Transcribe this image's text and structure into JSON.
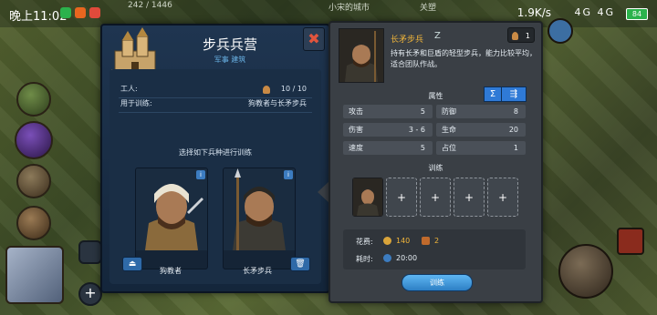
{
  "status_bar": {
    "time": "晚上11:02",
    "network_speed": "1.9K/s",
    "signal": "4G 4G",
    "battery": "84",
    "resource_count": "242 / 1446",
    "city_name": "小宋的城市",
    "ally_label": "关塑"
  },
  "barracks": {
    "title": "步兵兵营",
    "subtitle": "军事 建筑",
    "workers_label": "工人:",
    "workers_value": "10 / 10",
    "trains_label": "用于训练:",
    "trains_value": "狗教者与长矛步兵",
    "choose_text": "选择如下兵种进行训练",
    "units": [
      {
        "name": "狗教者",
        "info": "i"
      },
      {
        "name": "长矛步兵",
        "info": "i"
      }
    ],
    "close_icon": "close-x-icon"
  },
  "unit_detail": {
    "name": "长矛步兵",
    "rank_glyph": "Z",
    "count": "1",
    "description": "持有长矛和巨盾的轻型步兵，能力比较平均，适合团队作战。",
    "attributes_label": "属性",
    "sum_btn": "Σ",
    "stats": [
      {
        "label": "攻击",
        "value": "5"
      },
      {
        "label": "防御",
        "value": "8"
      },
      {
        "label": "伤害",
        "value": "3 - 6"
      },
      {
        "label": "生命",
        "value": "20"
      },
      {
        "label": "速度",
        "value": "5"
      },
      {
        "label": "占位",
        "value": "1"
      }
    ],
    "training_label": "训练",
    "slots": [
      "+",
      "+",
      "+",
      "+"
    ],
    "cost_label": "花费:",
    "cost_gold": "140",
    "cost_second": "2",
    "time_label": "耗时:",
    "time_value": "20:00",
    "train_button": "训练"
  },
  "colors": {
    "accent_gold": "#f0b53a",
    "accent_blue": "#2f7ad6",
    "close_red": "#e2553d"
  }
}
